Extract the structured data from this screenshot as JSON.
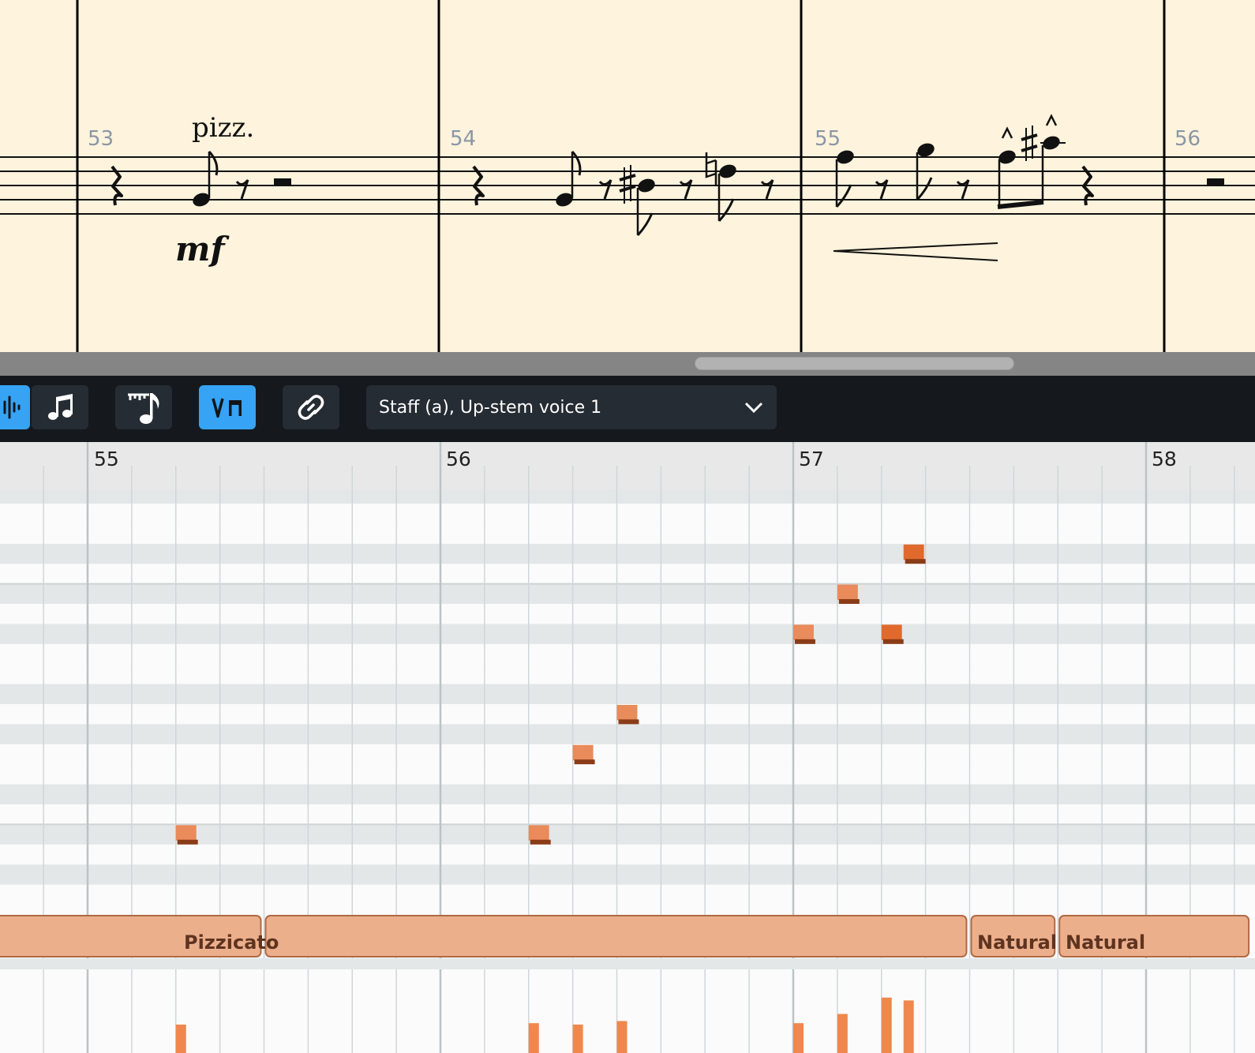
{
  "score": {
    "measures": [
      "53",
      "54",
      "55",
      "56"
    ],
    "technique_text": "pizz.",
    "dynamic_text": "mf"
  },
  "toolbar": {
    "buttons": [
      {
        "icon": "waveform-icon",
        "active": true
      },
      {
        "icon": "music-note-icon",
        "active": false
      },
      {
        "icon": "ruler-note-icon",
        "active": false
      },
      {
        "icon": "bowing-icon",
        "active": true
      },
      {
        "icon": "link-icon",
        "active": false
      }
    ],
    "voice_selector": "Staff (a), Up-stem voice 1"
  },
  "piano_roll": {
    "bar_numbers": [
      "55",
      "56",
      "57",
      "58"
    ],
    "notes": [
      {
        "bar": 55,
        "beat": 3,
        "length_beats": 0.5,
        "lane": 3
      },
      {
        "bar": 56,
        "beat": 3,
        "length_beats": 0.5,
        "lane": 3
      },
      {
        "bar": 56,
        "beat": 4,
        "length_beats": 0.5,
        "lane": 7
      },
      {
        "bar": 56,
        "beat": 5,
        "length_beats": 0.5,
        "lane": 9
      },
      {
        "bar": 57,
        "beat": 1,
        "length_beats": 0.5,
        "lane": 13,
        "level": 0.45
      },
      {
        "bar": 57,
        "beat": 2,
        "length_beats": 0.5,
        "lane": 15,
        "level": 0.55
      },
      {
        "bar": 57,
        "beat": 3,
        "length_beats": 0.5,
        "lane": 13,
        "level": 0.9
      },
      {
        "bar": 57,
        "beat": 3.5,
        "length_beats": 0.5,
        "lane": 17,
        "level": 0.8
      }
    ],
    "articulations": [
      {
        "label": "",
        "start": 54,
        "end": 55.5
      },
      {
        "label": "Pizzicato",
        "start": 55.5,
        "end": 57.5
      },
      {
        "label": "Natural",
        "start": 57.5,
        "end": 57.75
      },
      {
        "label": "Natural",
        "start": 57.75,
        "end": 58.3
      }
    ],
    "velocities": [
      0.4,
      0.42,
      0.4,
      0.45,
      0.42,
      0.55,
      0.78,
      0.74
    ],
    "colors": {
      "note": "#e8834f",
      "note_dark": "#8a3b17",
      "articulation": "#ecaf8c",
      "velocity": "#f0884e"
    }
  }
}
